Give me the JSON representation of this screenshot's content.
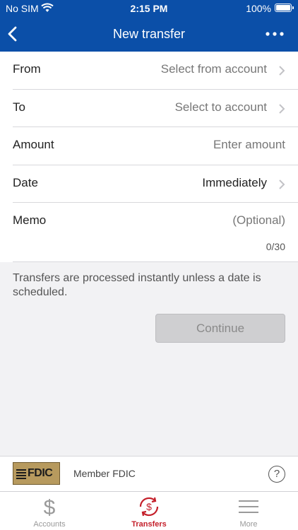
{
  "status_bar": {
    "carrier": "No SIM",
    "time": "2:15 PM",
    "battery": "100%"
  },
  "nav": {
    "title": "New transfer"
  },
  "form": {
    "from": {
      "label": "From",
      "value": "Select from account"
    },
    "to": {
      "label": "To",
      "value": "Select to account"
    },
    "amount": {
      "label": "Amount",
      "placeholder": "Enter amount"
    },
    "date": {
      "label": "Date",
      "value": "Immediately"
    },
    "memo": {
      "label": "Memo",
      "placeholder": "(Optional)",
      "counter": "0/30"
    }
  },
  "info_text": "Transfers are processed instantly unless a date is scheduled.",
  "continue_label": "Continue",
  "fdic": {
    "logo_text": "FDIC",
    "member_text": "Member FDIC",
    "help_icon": "?"
  },
  "tabs": [
    {
      "label": "Accounts",
      "icon": "dollar-icon",
      "active": false
    },
    {
      "label": "Transfers",
      "icon": "transfer-cycle-icon",
      "active": true
    },
    {
      "label": "More",
      "icon": "hamburger-icon",
      "active": false
    }
  ],
  "colors": {
    "brand_blue": "#0b4fa8",
    "active_tab_red": "#c41f2a",
    "disabled_button": "#cfcfd1"
  }
}
